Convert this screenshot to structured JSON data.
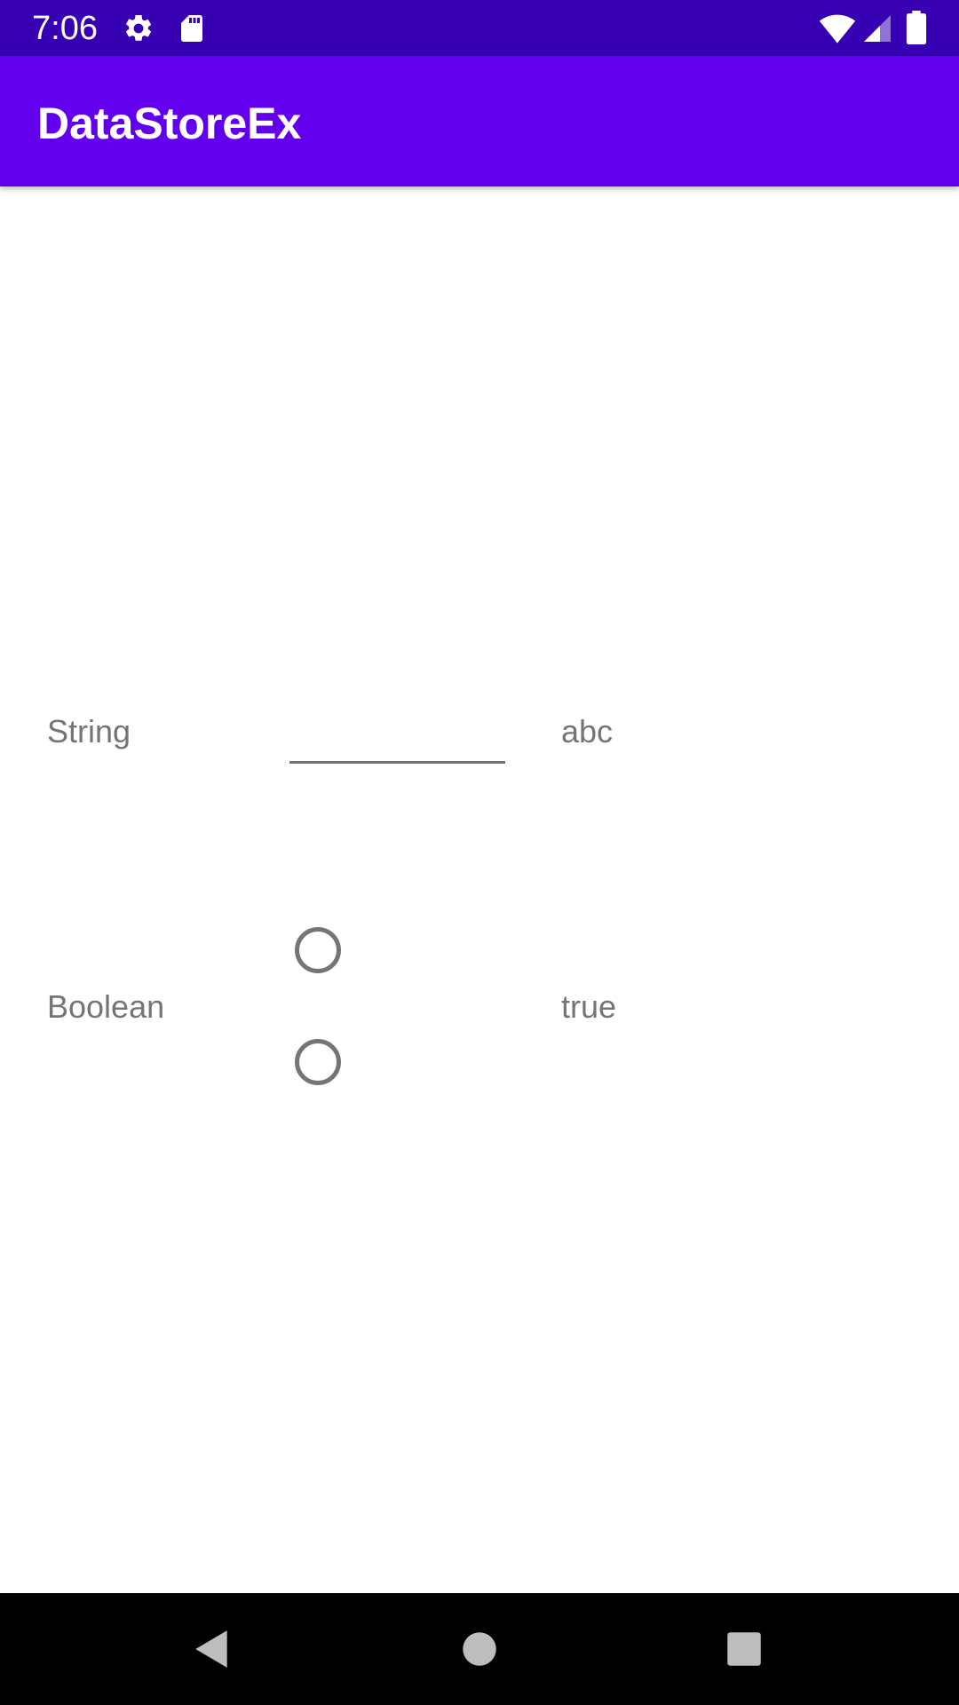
{
  "status_bar": {
    "time": "7:06",
    "icons": [
      "settings-icon",
      "sd-card-icon",
      "wifi-icon",
      "cell-signal-icon",
      "battery-icon"
    ]
  },
  "app_bar": {
    "title": "DataStoreEx",
    "color": "#6200ee",
    "status_color": "#3700b3"
  },
  "rows": {
    "string": {
      "label": "String",
      "input_value": "",
      "stored_value": "abc"
    },
    "boolean": {
      "label": "Boolean",
      "option_true_checked": false,
      "option_false_checked": false,
      "stored_value": "true"
    }
  },
  "nav_bar": {
    "icons": [
      "back-icon",
      "home-icon",
      "recents-icon"
    ]
  }
}
